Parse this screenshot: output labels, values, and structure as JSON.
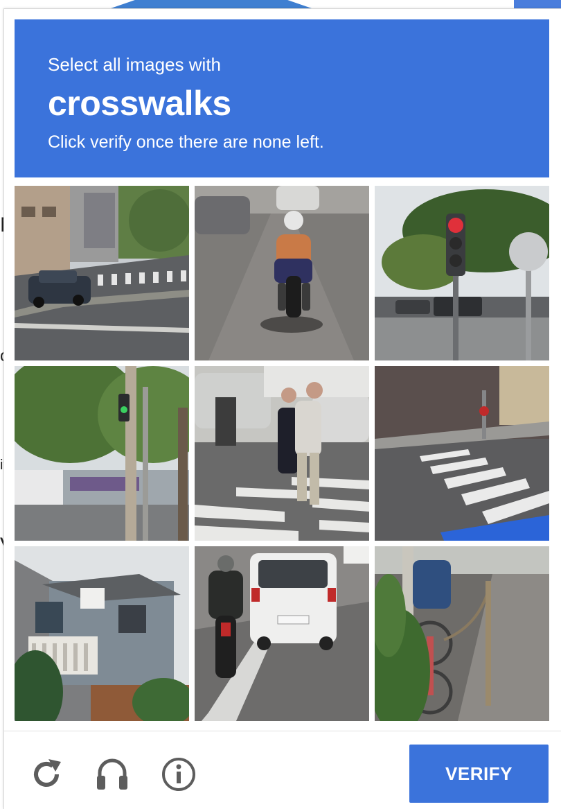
{
  "background_page": {
    "fragments": [
      "N",
      "o",
      "it",
      "V"
    ]
  },
  "challenge": {
    "instruction_prefix": "Select all images with",
    "target": "crosswalks",
    "instruction_suffix": "Click verify once there are none left.",
    "header_color": "#3b73db"
  },
  "tiles": [
    {
      "index": 1,
      "scene": "street corner with crosswalk and dark car"
    },
    {
      "index": 2,
      "scene": "motorcyclist on road"
    },
    {
      "index": 3,
      "scene": "traffic light with red signal"
    },
    {
      "index": 4,
      "scene": "trees and traffic signal"
    },
    {
      "index": 5,
      "scene": "pedestrians on crosswalk"
    },
    {
      "index": 6,
      "scene": "crosswalk on curved street"
    },
    {
      "index": 7,
      "scene": "houses"
    },
    {
      "index": 8,
      "scene": "white car and motorcyclist"
    },
    {
      "index": 9,
      "scene": "bicycle by sidewalk"
    }
  ],
  "footer": {
    "reload_icon": "reload-icon",
    "audio_icon": "headphones-icon",
    "info_icon": "info-icon",
    "verify_label": "VERIFY"
  }
}
